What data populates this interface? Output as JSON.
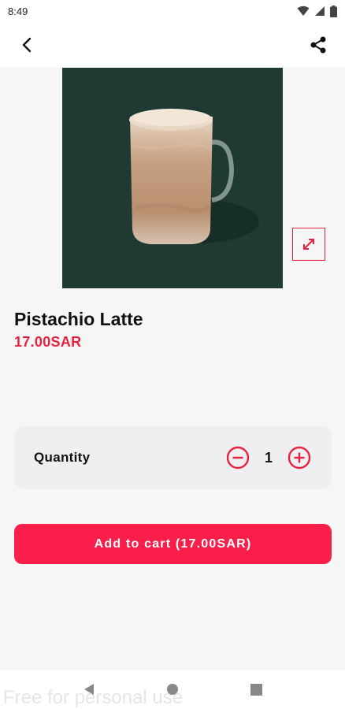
{
  "status_bar": {
    "time": "8:49",
    "icons": [
      "wifi-icon",
      "signal-icon",
      "battery-icon"
    ]
  },
  "app_bar": {
    "back_icon": "chevron-left-icon",
    "share_icon": "share-icon"
  },
  "product": {
    "name": "Pistachio Latte",
    "price": "17.00SAR",
    "image_background": "#1f3a33",
    "expand_icon": "expand-diagonal-icon"
  },
  "quantity": {
    "label": "Quantity",
    "value": "1",
    "decrement_icon": "minus-circle-icon",
    "increment_icon": "plus-circle-icon"
  },
  "cart_button": {
    "label": "Add to cart (17.00SAR)"
  },
  "nav_bar": {
    "icons": [
      "back-triangle-icon",
      "home-circle-icon",
      "recents-square-icon"
    ]
  },
  "watermark": "Free for personal use",
  "colors": {
    "accent": "#fa1e4b",
    "price": "#e8213e",
    "background": "#f6f6f6",
    "card": "#efeef1"
  }
}
